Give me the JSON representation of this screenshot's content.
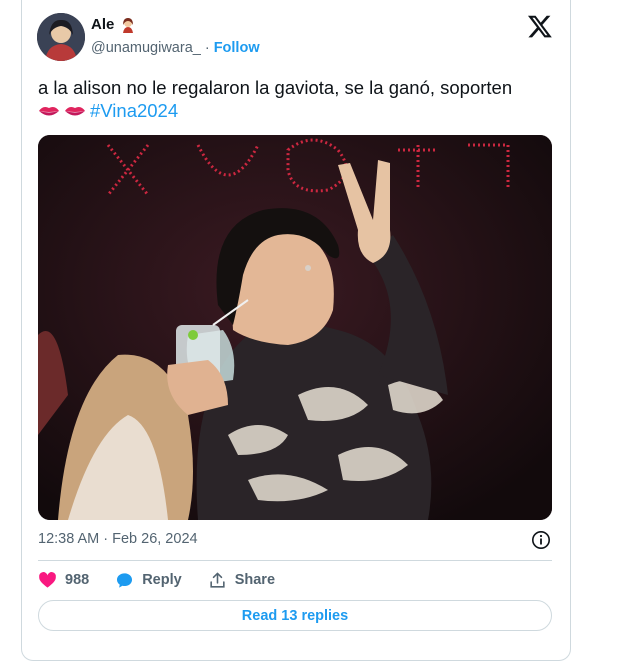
{
  "author": {
    "name": "Ale",
    "handle": "@unamugiwara_",
    "separator": "·",
    "follow_label": "Follow",
    "name_emoji_icon": "woman-emoji-icon"
  },
  "tweet": {
    "text": "a la alison no le regalaron la gaviota, se la ganó, soporten",
    "emojis": [
      "kiss-mark-icon",
      "kiss-mark-icon"
    ],
    "hashtag": "#Vina2024"
  },
  "meta": {
    "time": "12:38 AM",
    "separator": "·",
    "date": "Feb 26, 2024"
  },
  "actions": {
    "like_count": "988",
    "reply_label": "Reply",
    "share_label": "Share"
  },
  "read_replies_label": "Read 13 replies",
  "colors": {
    "accent": "#1d9bf0",
    "like": "#f91880",
    "muted": "#536471",
    "border": "#cfd9de"
  }
}
